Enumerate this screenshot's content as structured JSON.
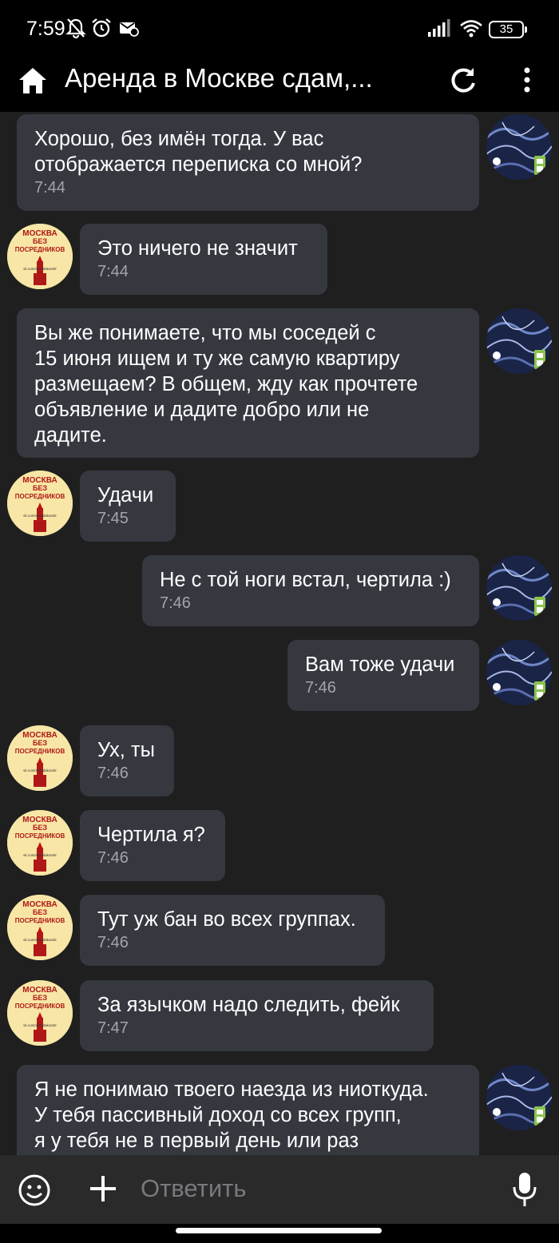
{
  "status_bar": {
    "time": "7:59",
    "battery": "35"
  },
  "header": {
    "title": "Аренда в Москве сдам,..."
  },
  "avatar_text": {
    "line1": "МОСКВА",
    "line2": "БЕЗ",
    "line3": "ПОСРЕДНИКОВ",
    "link": "vk.com/arendakvartir"
  },
  "messages": [
    {
      "text": "Хорошо, без имён тогда. У вас\nотображается переписка со мной?",
      "time": "7:44"
    },
    {
      "text": "Это ничего не значит",
      "time": "7:44"
    },
    {
      "text": "Вы же понимаете, что мы соседей с\n15 июня ищем и ту же самую квартиру\nразмещаем? В общем, жду как прочтете\nобъявление и дадите добро или не\nдадите.",
      "time": ""
    },
    {
      "text": "Удачи",
      "time": "7:45"
    },
    {
      "text": "Не с той ноги встал, чертила :)",
      "time": "7:46"
    },
    {
      "text": "Вам тоже удачи",
      "time": "7:46"
    },
    {
      "text": "Ух, ты",
      "time": "7:46"
    },
    {
      "text": "Чертила я?",
      "time": "7:46"
    },
    {
      "text": "Тут уж бан во всех группах.",
      "time": "7:46"
    },
    {
      "text": "За язычком надо следить, фейк",
      "time": "7:47"
    },
    {
      "text": "Я не понимаю твоего наезда из ниоткуда.\nУ тебя пассивный доход со всех групп,\nя у тебя не в первый день или раз",
      "time": ""
    }
  ],
  "input": {
    "placeholder": "Ответить"
  },
  "colors": {
    "background": "#1f1f1f",
    "bubble": "#363840",
    "time_text": "#a3a5ab",
    "phone_badge": "#8bc34a"
  }
}
